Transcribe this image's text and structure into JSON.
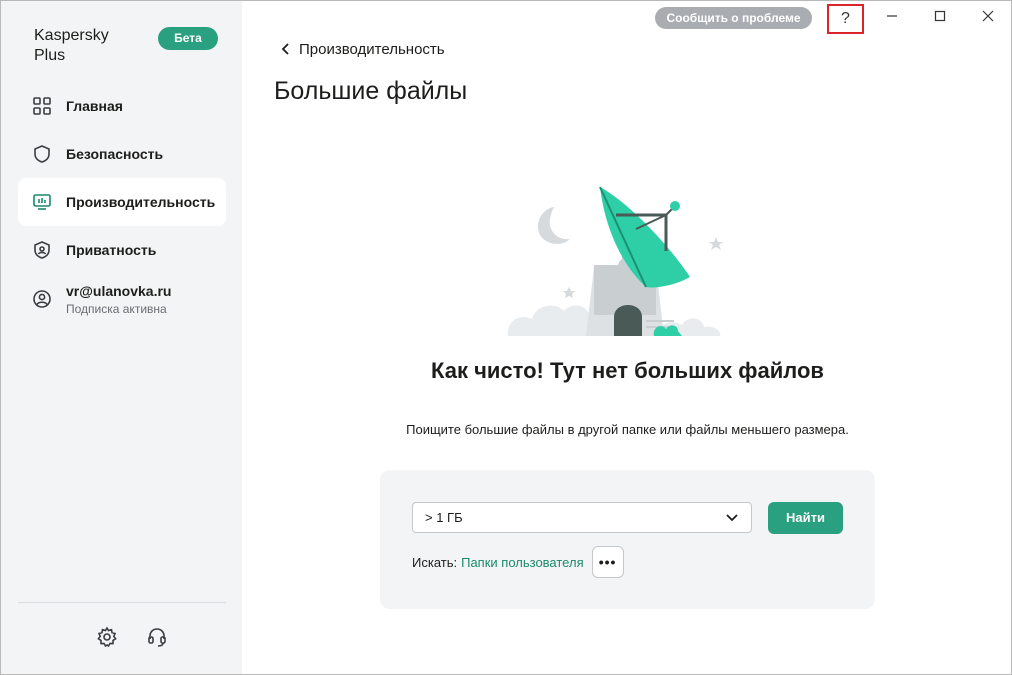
{
  "sidebar": {
    "brand": "Kaspersky\nPlus",
    "beta_badge": "Бета",
    "nav": [
      {
        "label": "Главная",
        "icon": "dashboard-icon"
      },
      {
        "label": "Безопасность",
        "icon": "shield-icon"
      },
      {
        "label": "Производительность",
        "icon": "performance-monitor-icon",
        "active": true
      },
      {
        "label": "Приватность",
        "icon": "privacy-shield-icon"
      }
    ],
    "account": {
      "email": "vr@ulanovka.ru",
      "status": "Подписка активна",
      "icon": "user-icon"
    },
    "bottom": [
      {
        "icon": "gear-icon"
      },
      {
        "icon": "headset-icon"
      }
    ]
  },
  "titlebar": {
    "report_label": "Сообщить о проблеме",
    "help_label": "?",
    "controls": [
      "minimize-icon",
      "maximize-icon",
      "close-icon"
    ]
  },
  "main": {
    "back_label": "Производительность",
    "title": "Большие файлы",
    "empty_title": "Как чисто! Тут нет больших файлов",
    "empty_subtitle": "Поищите большие файлы в другой папке или файлы меньшего размера.",
    "search": {
      "size_value": "> 1 ГБ",
      "find_label": "Найти",
      "search_prefix": "Искать:",
      "search_location": "Папки пользователя",
      "more_label": "•••"
    }
  },
  "colors": {
    "accent": "#29a07f",
    "link": "#1a8a6c",
    "sidebar_bg": "#f3f4f5",
    "report_btn": "#a9acb1",
    "help_highlight": "#d9242a"
  }
}
